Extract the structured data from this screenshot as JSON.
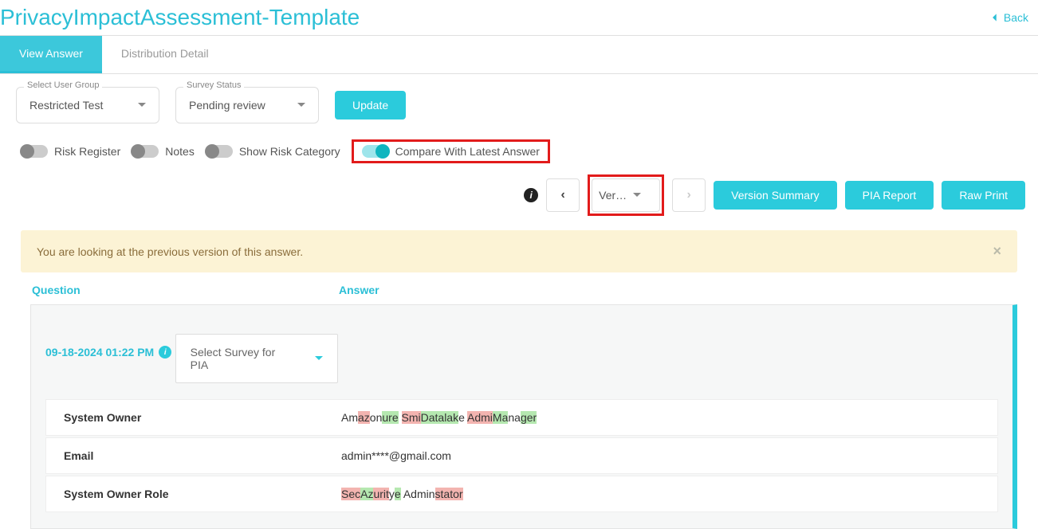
{
  "header": {
    "title": "PrivacyImpactAssessment-Template",
    "back_label": "Back"
  },
  "tabs": {
    "view_answer": "View Answer",
    "distribution_detail": "Distribution Detail"
  },
  "controls": {
    "user_group_label": "Select User Group",
    "user_group_value": "Restricted Test",
    "survey_status_label": "Survey Status",
    "survey_status_value": "Pending review",
    "update_button": "Update"
  },
  "toggles": {
    "risk_register": "Risk Register",
    "notes": "Notes",
    "show_risk_category": "Show Risk Category",
    "compare_latest": "Compare With Latest Answer"
  },
  "version_nav": {
    "label": "Ver…"
  },
  "buttons": {
    "version_summary": "Version Summary",
    "pia_report": "PIA Report",
    "raw_print": "Raw Print"
  },
  "alert": {
    "message": "You are looking at the previous version of this answer."
  },
  "columns": {
    "question": "Question",
    "answer": "Answer"
  },
  "panel": {
    "timestamp": "09-18-2024 01:22 PM",
    "survey_select": "Select Survey for PIA"
  },
  "rows": [
    {
      "question": "System Owner",
      "answer_segments": [
        {
          "text": "Am",
          "type": "none"
        },
        {
          "text": "az",
          "type": "del"
        },
        {
          "text": "on",
          "type": "none"
        },
        {
          "text": "ure",
          "type": "ins"
        },
        {
          "text": " ",
          "type": "none"
        },
        {
          "text": "Smi",
          "type": "del"
        },
        {
          "text": "Datalak",
          "type": "ins"
        },
        {
          "text": "e ",
          "type": "none"
        },
        {
          "text": "Admi",
          "type": "del"
        },
        {
          "text": "Ma",
          "type": "ins"
        },
        {
          "text": "na",
          "type": "none"
        },
        {
          "text": "ger",
          "type": "ins"
        }
      ]
    },
    {
      "question": "Email",
      "answer_plain": "admin****@gmail.com"
    },
    {
      "question": "System Owner Role",
      "answer_segments": [
        {
          "text": "Sec",
          "type": "del"
        },
        {
          "text": "Az",
          "type": "ins"
        },
        {
          "text": "urit",
          "type": "del"
        },
        {
          "text": "y",
          "type": "none"
        },
        {
          "text": "e",
          "type": "ins"
        },
        {
          "text": " Admin",
          "type": "none"
        },
        {
          "text": "stator",
          "type": "del"
        }
      ]
    }
  ]
}
